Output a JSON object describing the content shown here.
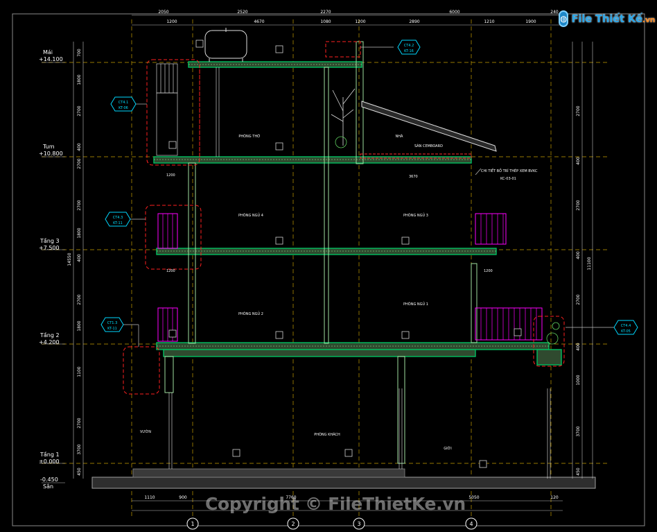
{
  "logo": {
    "brand": "File Thiết Kế",
    "suffix": ".vn"
  },
  "watermark": "Copyright © FileThietKe.vn",
  "colors": {
    "background": "#000000",
    "frame": "#b0b0b0",
    "grid": "#ffd400",
    "dims": "#ffffff",
    "slab": "#00c060",
    "slabFill": "#3a5a3a",
    "wall": "#ff3030",
    "tag": "#00e0ff",
    "railing": "#ff00ff",
    "ground": "#3a3a3a",
    "label": "#ffffff"
  },
  "top_dimensions": {
    "overall": [
      "2050",
      "2520",
      "2270",
      "6000",
      "240"
    ],
    "detail": [
      "1200",
      "4670",
      "1080",
      "1200",
      "2890",
      "1210",
      "1900"
    ]
  },
  "bottom_dimensions": [
    "1110",
    "900",
    "7760",
    "5050",
    "120"
  ],
  "grid_axes": [
    "1",
    "2",
    "3",
    "4"
  ],
  "levels": [
    {
      "name": "Mái",
      "value": "+14.100"
    },
    {
      "name": "Tum",
      "value": "+10.800"
    },
    {
      "name": "Tầng 3",
      "value": "+7.500"
    },
    {
      "name": "Tầng 2",
      "value": "+4.200"
    },
    {
      "name": "Tầng 1",
      "value": "±0.000"
    },
    {
      "name": "Sân",
      "value": "-0.450"
    }
  ],
  "left_dims": [
    "700",
    "1800",
    "2700",
    "400",
    "2700",
    "2700",
    "1800",
    "400",
    "2700",
    "1800",
    "1100",
    "2700",
    "3700",
    "450"
  ],
  "left_total": "14550",
  "right_dims": [
    "2700",
    "400",
    "2700",
    "400",
    "2700",
    "400",
    "3700",
    "450",
    "1000"
  ],
  "right_total": "11100",
  "rooms": {
    "tho": "PHÒNG THỜ",
    "ngu4": "PHÒNG NGỦ 4",
    "ngu3": "PHÒNG NGỦ 3",
    "ngu2": "PHÒNG NGỦ 2",
    "ngu1": "PHÒNG NGỦ 1",
    "khach": "PHÒNG KHÁCH",
    "vuon": "VƯỜN",
    "gioi": "GIỚI",
    "nha": "NHÀ"
  },
  "notes": {
    "slab_note": "SÀN CEMBOARD",
    "detail_note": "CHI TIẾT BỒ TRÍ THÉP XEM BVKC",
    "detail_ref": "KC-03-01",
    "dim_3670": "3670",
    "dim_1200a": "1200",
    "dim_1200b": "1200",
    "dim_1200c": "1200"
  },
  "section_tags": [
    {
      "code": "CT4.1",
      "sheet": "KT-06"
    },
    {
      "code": "CT4.2",
      "sheet": "KT-16"
    },
    {
      "code": "CT4.3",
      "sheet": "KT-11"
    },
    {
      "code": "CT1.3",
      "sheet": "KT-11"
    },
    {
      "code": "CT4.4",
      "sheet": "KT-05"
    }
  ]
}
